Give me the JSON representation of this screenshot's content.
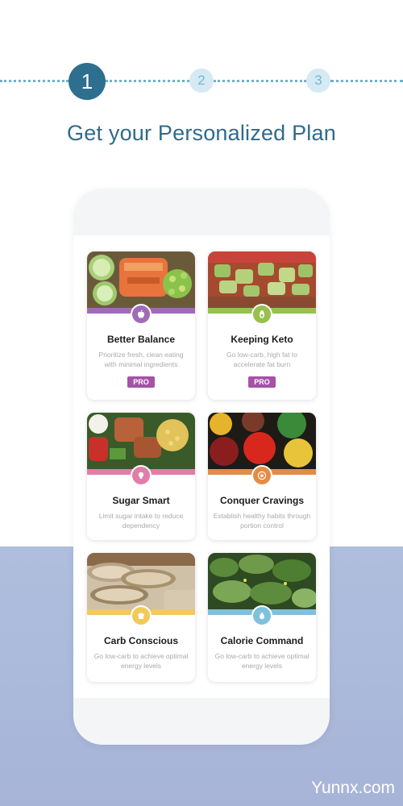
{
  "steps": [
    {
      "label": "1",
      "active": true
    },
    {
      "label": "2",
      "active": false
    },
    {
      "label": "3",
      "active": false
    }
  ],
  "title": "Get your Personalized Plan",
  "plans": [
    {
      "name": "Better Balance",
      "description": "Prioritize fresh, clean eating with minimal ingredients",
      "pro_label": "PRO",
      "color": "#a06bb9",
      "icon": "apple-icon"
    },
    {
      "name": "Keeping Keto",
      "description": "Go low-carb, high fat to accelerate fat burn",
      "pro_label": "PRO",
      "color": "#97c04d",
      "icon": "avocado-icon"
    },
    {
      "name": "Sugar Smart",
      "description": "Limit sugar intake to reduce dependency",
      "color": "#e47ca9",
      "icon": "lightbulb-icon"
    },
    {
      "name": "Conquer Cravings",
      "description": "Establish healthy habits through portion control",
      "color": "#e58b44",
      "icon": "star-badge-icon"
    },
    {
      "name": "Carb Conscious",
      "description": "Go low-carb to achieve optimal energy levels",
      "color": "#f2c95a",
      "icon": "bread-icon"
    },
    {
      "name": "Calorie Command",
      "description": "Go low-carb to achieve optimal energy levels",
      "color": "#7fc0df",
      "icon": "water-drop-icon"
    }
  ],
  "watermark": "Yunnx.com"
}
